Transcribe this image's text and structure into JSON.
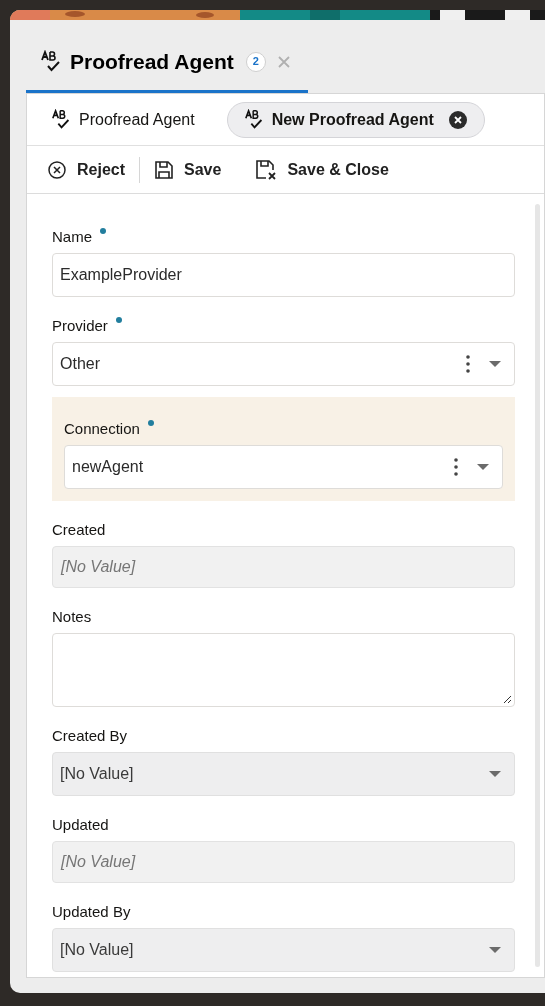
{
  "header": {
    "title": "Proofread Agent",
    "count": "2"
  },
  "subtabs": [
    {
      "label": "Proofread Agent",
      "selected": false,
      "closable": false
    },
    {
      "label": "New Proofread Agent",
      "selected": true,
      "closable": true
    }
  ],
  "toolbar": [
    {
      "label": "Reject",
      "kind": "reject"
    },
    {
      "label": "Save",
      "kind": "save"
    },
    {
      "label": "Save & Close",
      "kind": "save-close"
    }
  ],
  "fields": [
    {
      "label": "Name",
      "required": true,
      "kind": "text",
      "value": "ExampleProvider",
      "highlighted": false
    },
    {
      "label": "Provider",
      "required": true,
      "kind": "select",
      "value": "Other",
      "highlighted": false
    },
    {
      "label": "Connection",
      "required": true,
      "kind": "select",
      "value": "newAgent",
      "highlighted": true
    },
    {
      "label": "Created",
      "required": false,
      "kind": "readonly",
      "placeholder": "[No Value]",
      "highlighted": false
    },
    {
      "label": "Notes",
      "required": false,
      "kind": "textarea",
      "highlighted": false
    },
    {
      "label": "Created By",
      "required": false,
      "kind": "readonly-select",
      "value": "[No Value]",
      "highlighted": false
    },
    {
      "label": "Updated",
      "required": false,
      "kind": "readonly",
      "placeholder": "[No Value]",
      "highlighted": false
    },
    {
      "label": "Updated By",
      "required": false,
      "kind": "readonly-select",
      "value": "[No Value]",
      "highlighted": false
    }
  ]
}
